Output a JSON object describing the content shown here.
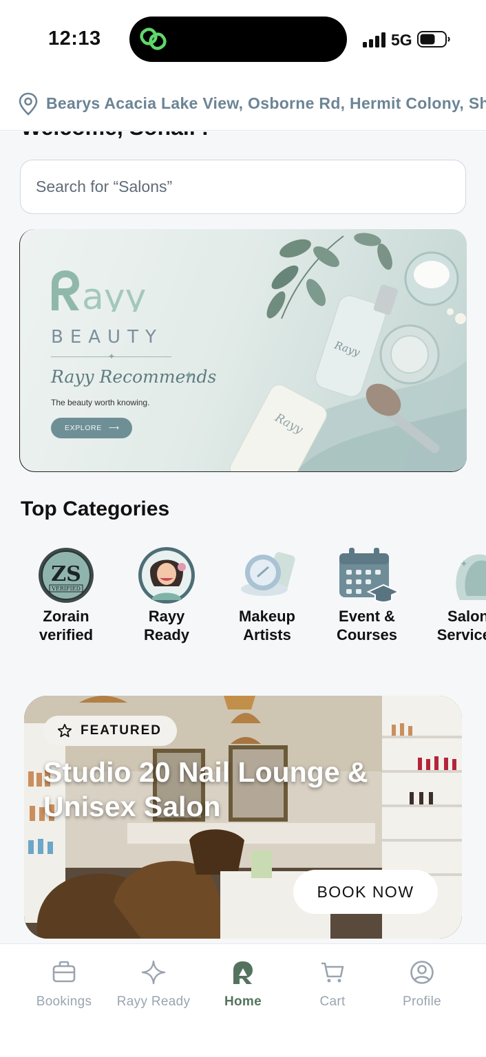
{
  "status_bar": {
    "time": "12:13",
    "network": "5G"
  },
  "location": {
    "address": "Bearys Acacia Lake View, Osborne Rd, Hermit Colony, Shivaji Nagar, Bengaluru"
  },
  "greeting": "Welcome, Sohail !",
  "search": {
    "placeholder": "Search for “Salons”"
  },
  "banner": {
    "brand_wordmark": "Rayy",
    "brand_sub": "BEAUTY",
    "recommends": "Rayy Recommends",
    "tagline": "The beauty worth knowing.",
    "cta": "EXPLORE"
  },
  "categories": {
    "title": "Top Categories",
    "items": [
      {
        "line1": "Zorain",
        "line2": "verified",
        "icon": "zs-verified-badge"
      },
      {
        "line1": "Rayy",
        "line2": "Ready",
        "icon": "makeup-woman-avatar"
      },
      {
        "line1": "Makeup",
        "line2": "Artists",
        "icon": "compact-mirror"
      },
      {
        "line1": "Event &",
        "line2": "Courses",
        "icon": "calendar-graduation-cap"
      },
      {
        "line1": "Salon",
        "line2": "Services",
        "icon": "hair-silhouette"
      }
    ]
  },
  "featured": {
    "badge": "FEATURED",
    "title": "Studio 20 Nail Lounge & Unisex Salon",
    "cta": "BOOK NOW"
  },
  "tabs": [
    {
      "label": "Bookings",
      "icon": "briefcase-icon"
    },
    {
      "label": "Rayy Ready",
      "icon": "sparkle-icon"
    },
    {
      "label": "Home",
      "icon": "rayy-logo-icon",
      "active": true
    },
    {
      "label": "Cart",
      "icon": "cart-icon"
    },
    {
      "label": "Profile",
      "icon": "profile-icon"
    }
  ],
  "colors": {
    "accent": "#54735f",
    "location_text": "#6c8495",
    "tab_inactive": "#9aa4af"
  }
}
